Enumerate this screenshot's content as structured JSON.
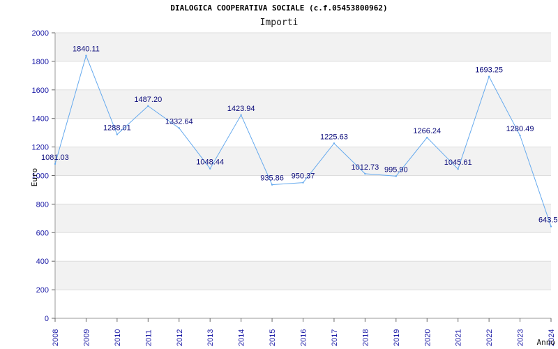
{
  "chart_data": {
    "type": "line",
    "title": "DIALOGICA COOPERATIVA SOCIALE (c.f.05453800962)",
    "subtitle": "Importi",
    "xlabel": "Anno",
    "ylabel": "Euro",
    "ylim": [
      0,
      2000
    ],
    "y_ticks": [
      "0",
      "200",
      "400",
      "600",
      "800",
      "1000",
      "1200",
      "1400",
      "1600",
      "1800",
      "2000"
    ],
    "grid": "horizontal bands",
    "colors": {
      "line": "#66aaee",
      "band": "#f2f2f2",
      "tick_text": "#1a1aa6",
      "label_text": "#0a0a7a"
    },
    "x": [
      "2008",
      "2009",
      "2010",
      "2011",
      "2012",
      "2013",
      "2014",
      "2015",
      "2016",
      "2017",
      "2018",
      "2019",
      "2020",
      "2021",
      "2022",
      "2023",
      "2024"
    ],
    "values": [
      1081.03,
      1840.11,
      1288.01,
      1487.2,
      1332.64,
      1048.44,
      1423.94,
      935.86,
      950.37,
      1225.63,
      1012.73,
      995.9,
      1266.24,
      1045.61,
      1693.25,
      1280.49,
      643.5
    ],
    "labels": [
      "1081.03",
      "1840.11",
      "1288.01",
      "1487.20",
      "1332.64",
      "1048.44",
      "1423.94",
      "935.86",
      "950.37",
      "1225.63",
      "1012.73",
      "995.90",
      "1266.24",
      "1045.61",
      "1693.25",
      "1280.49",
      "643.5"
    ]
  }
}
